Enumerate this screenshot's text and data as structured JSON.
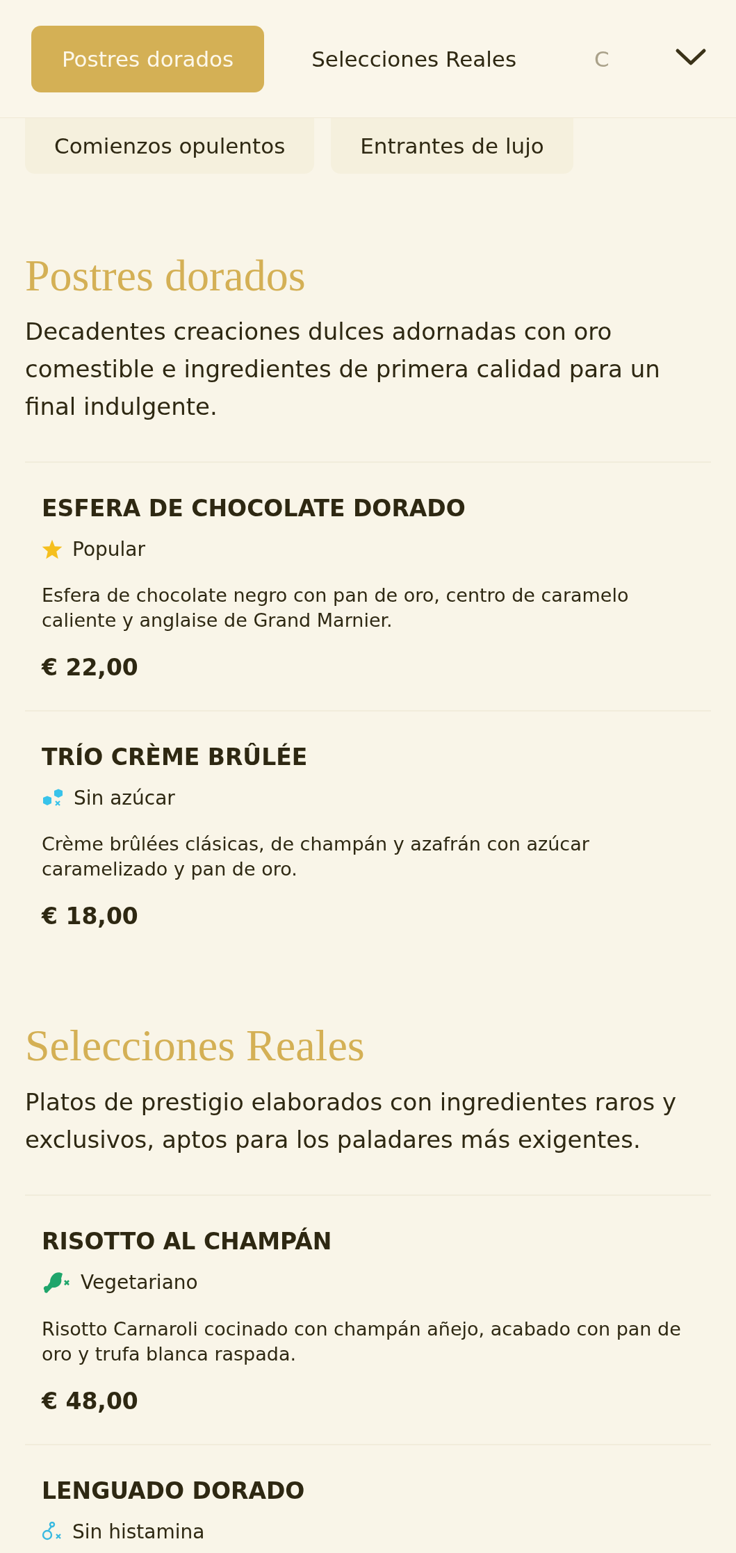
{
  "tabs": [
    {
      "label": "Postres dorados",
      "selected": true
    },
    {
      "label": "Selecciones Reales",
      "selected": false
    },
    {
      "label": "C",
      "selected": false
    }
  ],
  "chips": [
    {
      "label": "Comienzos opulentos"
    },
    {
      "label": "Entrantes de lujo"
    }
  ],
  "sections": [
    {
      "title": "Postres dorados",
      "description": "Decadentes creaciones dulces adornadas con oro comestible e ingredientes de primera calidad para un final indulgente.",
      "items": [
        {
          "name": "ESFERA DE CHOCOLATE DORADO",
          "tag": {
            "kind": "popular",
            "label": "Popular"
          },
          "description": "Esfera de chocolate negro con pan de oro, centro de caramelo caliente y anglaise de Grand Marnier.",
          "price": "€ 22,00"
        },
        {
          "name": "TRÍO CRÈME BRÛLÉE",
          "tag": {
            "kind": "sugar-free",
            "label": "Sin azúcar"
          },
          "description": "Crème brûlées clásicas, de champán y azafrán con azúcar caramelizado y pan de oro.",
          "price": "€ 18,00"
        }
      ]
    },
    {
      "title": "Selecciones Reales",
      "description": "Platos de prestigio elaborados con ingredientes raros y exclusivos, aptos para los paladares más exigentes.",
      "items": [
        {
          "name": "RISOTTO AL CHAMPÁN",
          "tag": {
            "kind": "vegetarian",
            "label": "Vegetariano"
          },
          "description": "Risotto Carnaroli cocinado con champán añejo, acabado con pan de oro y trufa blanca raspada.",
          "price": "€ 48,00"
        },
        {
          "name": "LENGUADO DORADO",
          "tag": {
            "kind": "histamine-free",
            "label": "Sin histamina"
          }
        }
      ]
    }
  ]
}
